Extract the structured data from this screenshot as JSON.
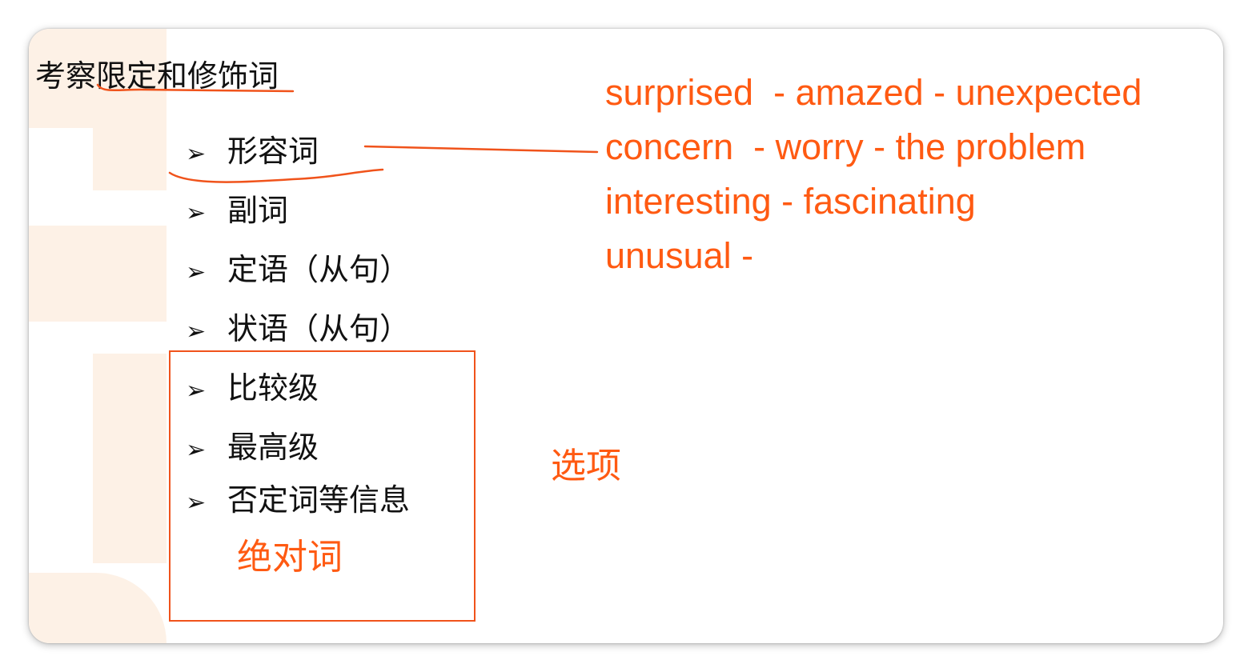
{
  "slide": {
    "title": "考察限定和修饰词",
    "items": [
      {
        "bullet": "➢",
        "text": "形容词"
      },
      {
        "bullet": "➢",
        "text": "副词"
      },
      {
        "bullet": "➢",
        "text": "定语（从句）"
      },
      {
        "bullet": "➢",
        "text": "状语（从句）"
      },
      {
        "bullet": "➢",
        "text": "比较级"
      },
      {
        "bullet": "➢",
        "text": "最高级"
      },
      {
        "bullet": "➢",
        "text": "否定词等信息"
      }
    ]
  },
  "annotations": {
    "synonym_lines": [
      "surprised  - amazed - unexpected",
      "concern  - worry - the problem",
      "interesting - fascinating",
      "unusual -"
    ],
    "options_label": "选项",
    "absolute_words_label": "绝对词",
    "ink_color": "#ff5a12"
  }
}
